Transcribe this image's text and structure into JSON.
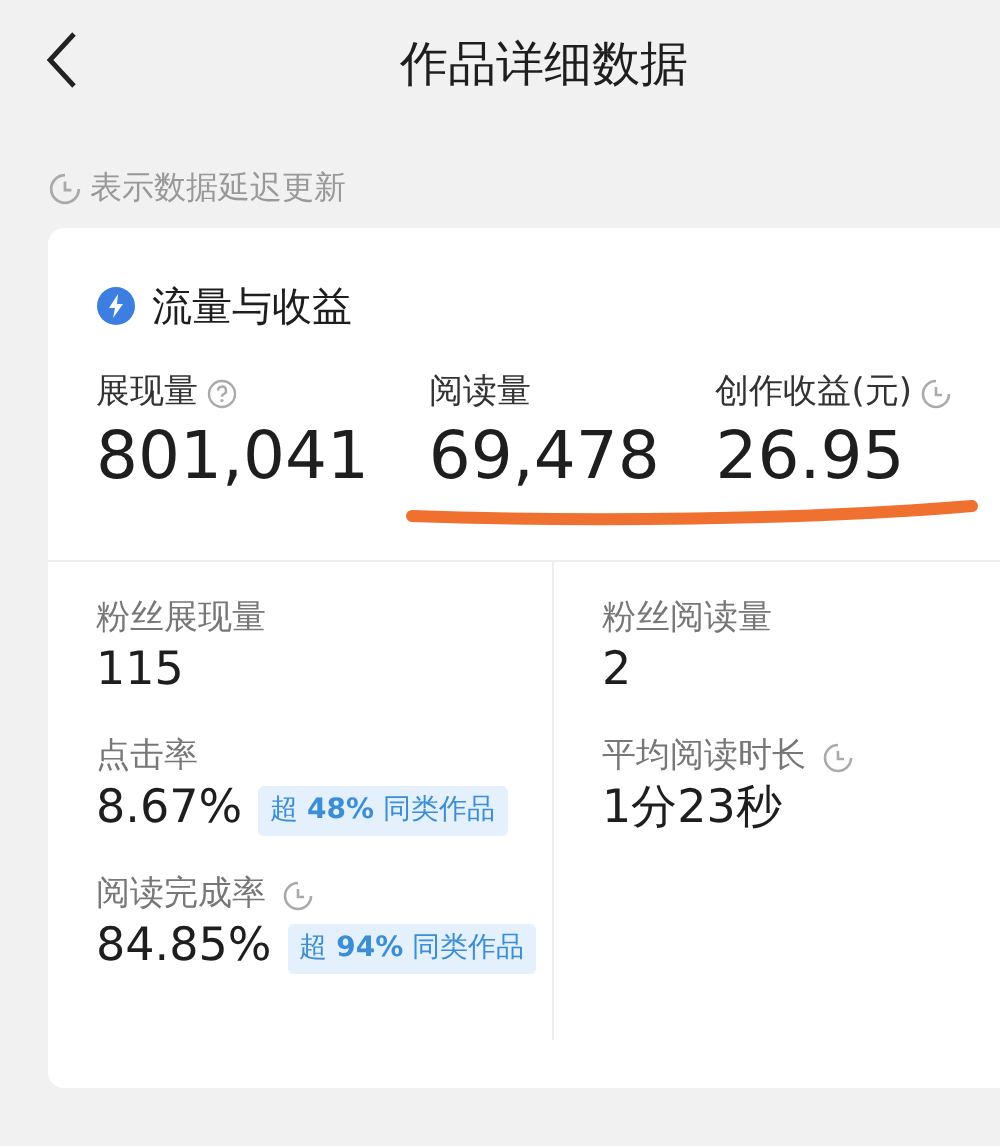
{
  "header": {
    "title": "作品详细数据"
  },
  "notice": {
    "text": "表示数据延迟更新"
  },
  "card": {
    "title": "流量与收益",
    "metrics": [
      {
        "label": "展现量",
        "value": "801,041",
        "kind": "help"
      },
      {
        "label": "阅读量",
        "value": "69,478",
        "kind": "plain"
      },
      {
        "label": "创作收益(元)",
        "value": "26.95",
        "kind": "delayed"
      }
    ],
    "detail_columns": [
      [
        {
          "label": "粉丝展现量",
          "value": "115",
          "kind": "plain"
        },
        {
          "label": "点击率",
          "value": "8.67%",
          "kind": "plain",
          "badge": "超 **48%** 同类作品"
        },
        {
          "label": "阅读完成率",
          "value": "84.85%",
          "kind": "delayed",
          "badge": "超 **94%** 同类作品"
        }
      ],
      [
        {
          "label": "粉丝阅读量",
          "value": "2",
          "kind": "plain"
        },
        {
          "label": "平均阅读时长",
          "value": "1分23秒",
          "kind": "delayed"
        }
      ]
    ]
  }
}
